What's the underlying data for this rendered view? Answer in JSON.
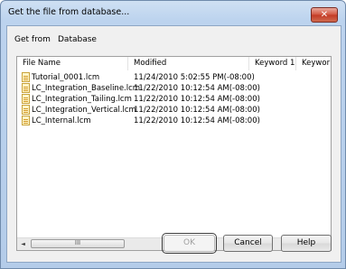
{
  "window": {
    "title": "Get the file from database..."
  },
  "menu": {
    "items": [
      "Get from",
      "Database"
    ]
  },
  "table": {
    "columns": [
      "File Name",
      "Modified",
      "Keyword 1",
      "Keywor"
    ],
    "rows": [
      {
        "name": "Tutorial_0001.lcm",
        "modified": "11/24/2010 5:02:55 PM(-08:00)"
      },
      {
        "name": "LC_Integration_Baseline.lcm",
        "modified": "11/22/2010 10:12:54 AM(-08:00)"
      },
      {
        "name": "LC_Integration_Tailing.lcm",
        "modified": "11/22/2010 10:12:54 AM(-08:00)"
      },
      {
        "name": "LC_Integration_Vertical.lcm",
        "modified": "11/22/2010 10:12:54 AM(-08:00)"
      },
      {
        "name": "LC_Internal.lcm",
        "modified": "11/22/2010 10:12:54 AM(-08:00)"
      }
    ]
  },
  "scrollbar": {
    "thumb_grip": "III",
    "left_arrow": "◄",
    "right_arrow": "►"
  },
  "buttons": {
    "ok": "OK",
    "cancel": "Cancel",
    "help": "Help",
    "close": "✕"
  },
  "icons": {
    "close": "close-icon",
    "file": "file-icon"
  }
}
